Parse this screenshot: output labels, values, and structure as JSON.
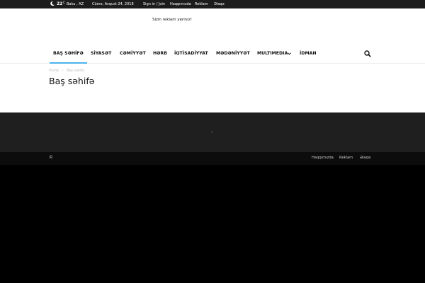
{
  "topbar": {
    "weather_icon": "moon-icon",
    "temperature": "22",
    "degree": "C",
    "location": "Baku , AZ",
    "date": "Cümə, Avqust 24, 2018",
    "signin": "Sign in / Join",
    "about": "Haqqımızda",
    "ads": "Reklam",
    "contact": "Əlaqə"
  },
  "header": {
    "ad_text": "Sizin reklam yeriniz!"
  },
  "nav": {
    "items": [
      "BAŞ SƏHİFƏ",
      "SİYASƏT",
      "CƏMİYYƏT",
      "HƏRB",
      "İQTİSADİYYAT",
      "MƏDƏNİYYƏT",
      "MULTIMEDIA",
      "İDMAN"
    ],
    "accent": "#4db2ec",
    "search_icon": "search-icon"
  },
  "breadcrumb": {
    "home": "Home",
    "separator": "›",
    "current": "Baş səhifə"
  },
  "page": {
    "title": "Baş səhifə"
  },
  "footer": {
    "mark": "»"
  },
  "subfooter": {
    "copyright": "©",
    "links": [
      "Haqqımızda",
      "Reklam",
      "Əlaqə"
    ]
  }
}
